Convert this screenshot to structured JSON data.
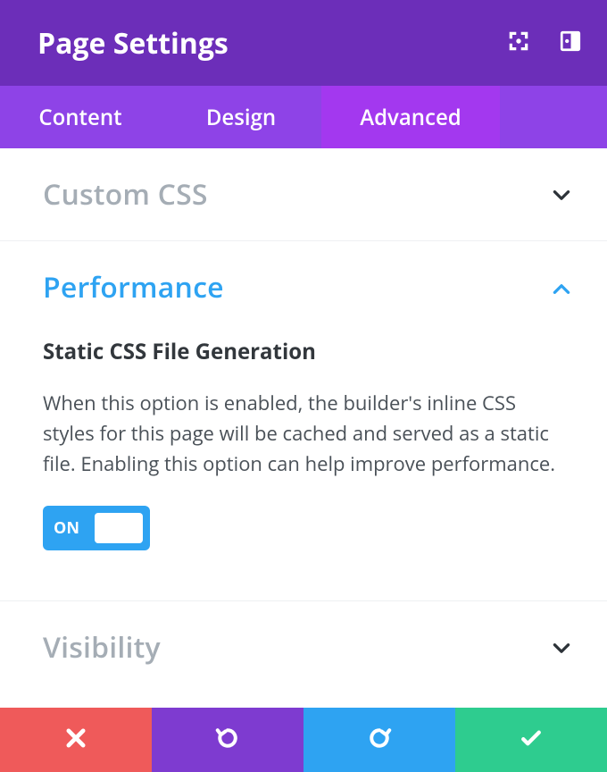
{
  "header": {
    "title": "Page Settings"
  },
  "tabs": {
    "content": "Content",
    "design": "Design",
    "advanced": "Advanced",
    "active": "advanced"
  },
  "sections": {
    "custom_css": {
      "title": "Custom CSS",
      "expanded": false
    },
    "performance": {
      "title": "Performance",
      "expanded": true,
      "option": {
        "title": "Static CSS File Generation",
        "description": "When this option is enabled, the builder's inline CSS styles for this page will be cached and served as a static file. Enabling this option can help improve performance.",
        "toggle_state": "ON"
      }
    },
    "visibility": {
      "title": "Visibility",
      "expanded": false
    }
  },
  "footer": {
    "cancel": "cancel",
    "undo": "undo",
    "redo": "redo",
    "save": "save"
  }
}
